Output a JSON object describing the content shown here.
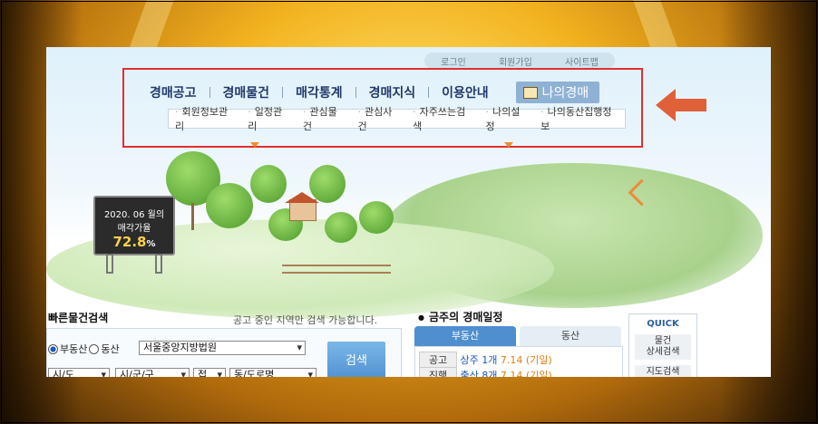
{
  "utility_links": [
    "로그인",
    "회원가입",
    "사이트맵"
  ],
  "nav": {
    "items": [
      "경매공고",
      "경매물건",
      "매각통계",
      "경매지식",
      "이용안내"
    ],
    "my": "나의경매"
  },
  "subnav": [
    "회원정보관리",
    "일정관리",
    "관심물건",
    "관심사건",
    "자주쓰는검색",
    "나의설정",
    "나의동산집행정보"
  ],
  "sign": {
    "month": "2020. 06 월의",
    "label": "매각가율",
    "rate": "72.8",
    "unit": "%"
  },
  "quick_search": {
    "title": "빠른물건검색",
    "note": "공고 중인 지역만 검색 가능합니다.",
    "radio_real": "부동산",
    "radio_movable": "동산",
    "court": "서울중앙지방법원",
    "si": "시/도",
    "gu": "시/군/구",
    "dong": "접",
    "road": "동/도로명",
    "button": "검색"
  },
  "schedule": {
    "title": "금주의 경매일정",
    "tab_real": "부동산",
    "tab_movable": "동산",
    "rows": [
      {
        "label": "공고",
        "text": "상주 1개",
        "date": "7.14 (기일)"
      },
      {
        "label": "진행",
        "text": "출산 8개",
        "date": "7.14 (기일)"
      }
    ]
  },
  "quick": {
    "title": "QUICK",
    "btn1": "물건\n상세검색",
    "btn2": "지도검색"
  },
  "colors": {
    "highlight": "#e03030",
    "arrow": "#e0603a",
    "accent": "#4f8fd0"
  }
}
